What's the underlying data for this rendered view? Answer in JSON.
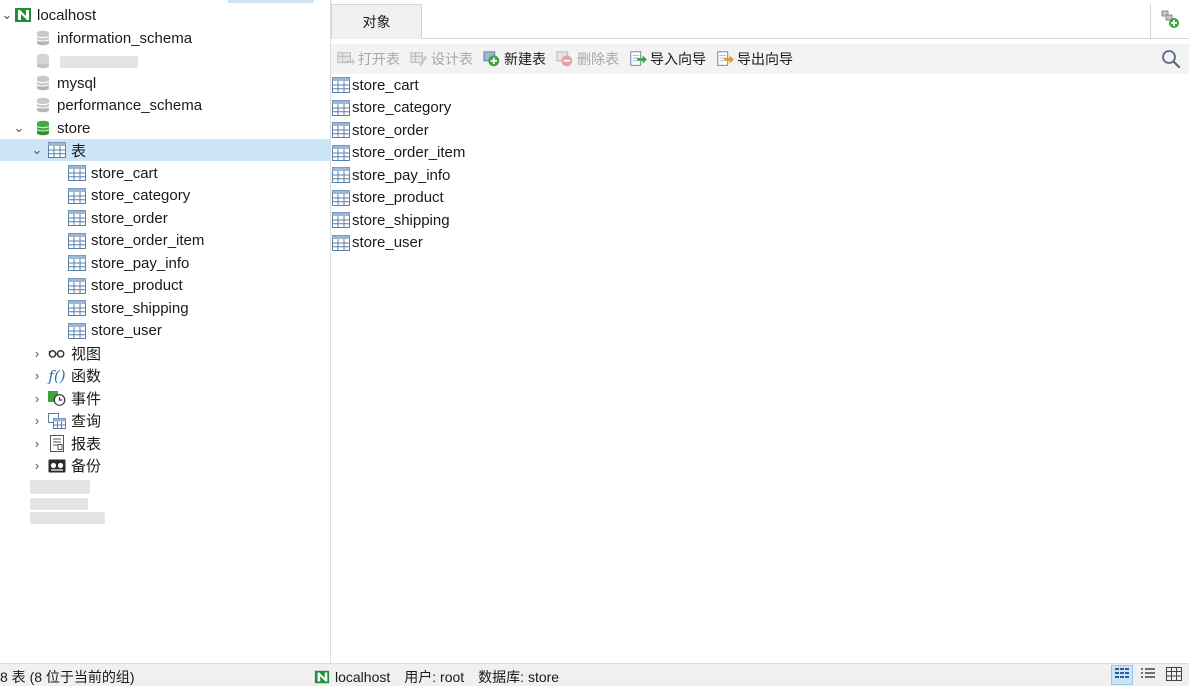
{
  "sidebar": {
    "connection": {
      "label": "localhost",
      "icon": "connection-icon",
      "expanded": true
    },
    "databases": [
      {
        "label": "information_schema",
        "icon": "database-icon"
      },
      {
        "label": "",
        "icon": "database-icon"
      },
      {
        "label": "mysql",
        "icon": "database-icon"
      },
      {
        "label": "performance_schema",
        "icon": "database-icon"
      },
      {
        "label": "store",
        "icon": "database-active-icon",
        "expanded": true
      }
    ],
    "tables_node": {
      "label": "表",
      "icon": "table-icon",
      "expanded": true,
      "selected": true
    },
    "tables": [
      {
        "label": "store_cart"
      },
      {
        "label": "store_category"
      },
      {
        "label": "store_order"
      },
      {
        "label": "store_order_item"
      },
      {
        "label": "store_pay_info"
      },
      {
        "label": "store_product"
      },
      {
        "label": "store_shipping"
      },
      {
        "label": "store_user"
      }
    ],
    "other_nodes": [
      {
        "label": "视图",
        "icon": "view-icon"
      },
      {
        "label": "函数",
        "icon": "function-icon"
      },
      {
        "label": "事件",
        "icon": "event-icon"
      },
      {
        "label": "查询",
        "icon": "query-icon"
      },
      {
        "label": "报表",
        "icon": "report-icon"
      },
      {
        "label": "备份",
        "icon": "backup-icon"
      }
    ]
  },
  "main": {
    "tab": {
      "label": "对象"
    },
    "toolbar": {
      "open": "打开表",
      "design": "设计表",
      "new": "新建表",
      "delete": "删除表",
      "import": "导入向导",
      "export": "导出向导"
    },
    "objects": [
      {
        "label": "store_cart"
      },
      {
        "label": "store_category"
      },
      {
        "label": "store_order"
      },
      {
        "label": "store_order_item"
      },
      {
        "label": "store_pay_info"
      },
      {
        "label": "store_product"
      },
      {
        "label": "store_shipping"
      },
      {
        "label": "store_user"
      }
    ]
  },
  "status": {
    "left": "8 表 (8 位于当前的组)",
    "connection": "localhost",
    "user": "用户: root",
    "database": "数据库: store"
  },
  "colors": {
    "selected": "#cce4f7",
    "toolbar_bg": "#f3f3f3",
    "accent_green": "#3aa53a"
  }
}
